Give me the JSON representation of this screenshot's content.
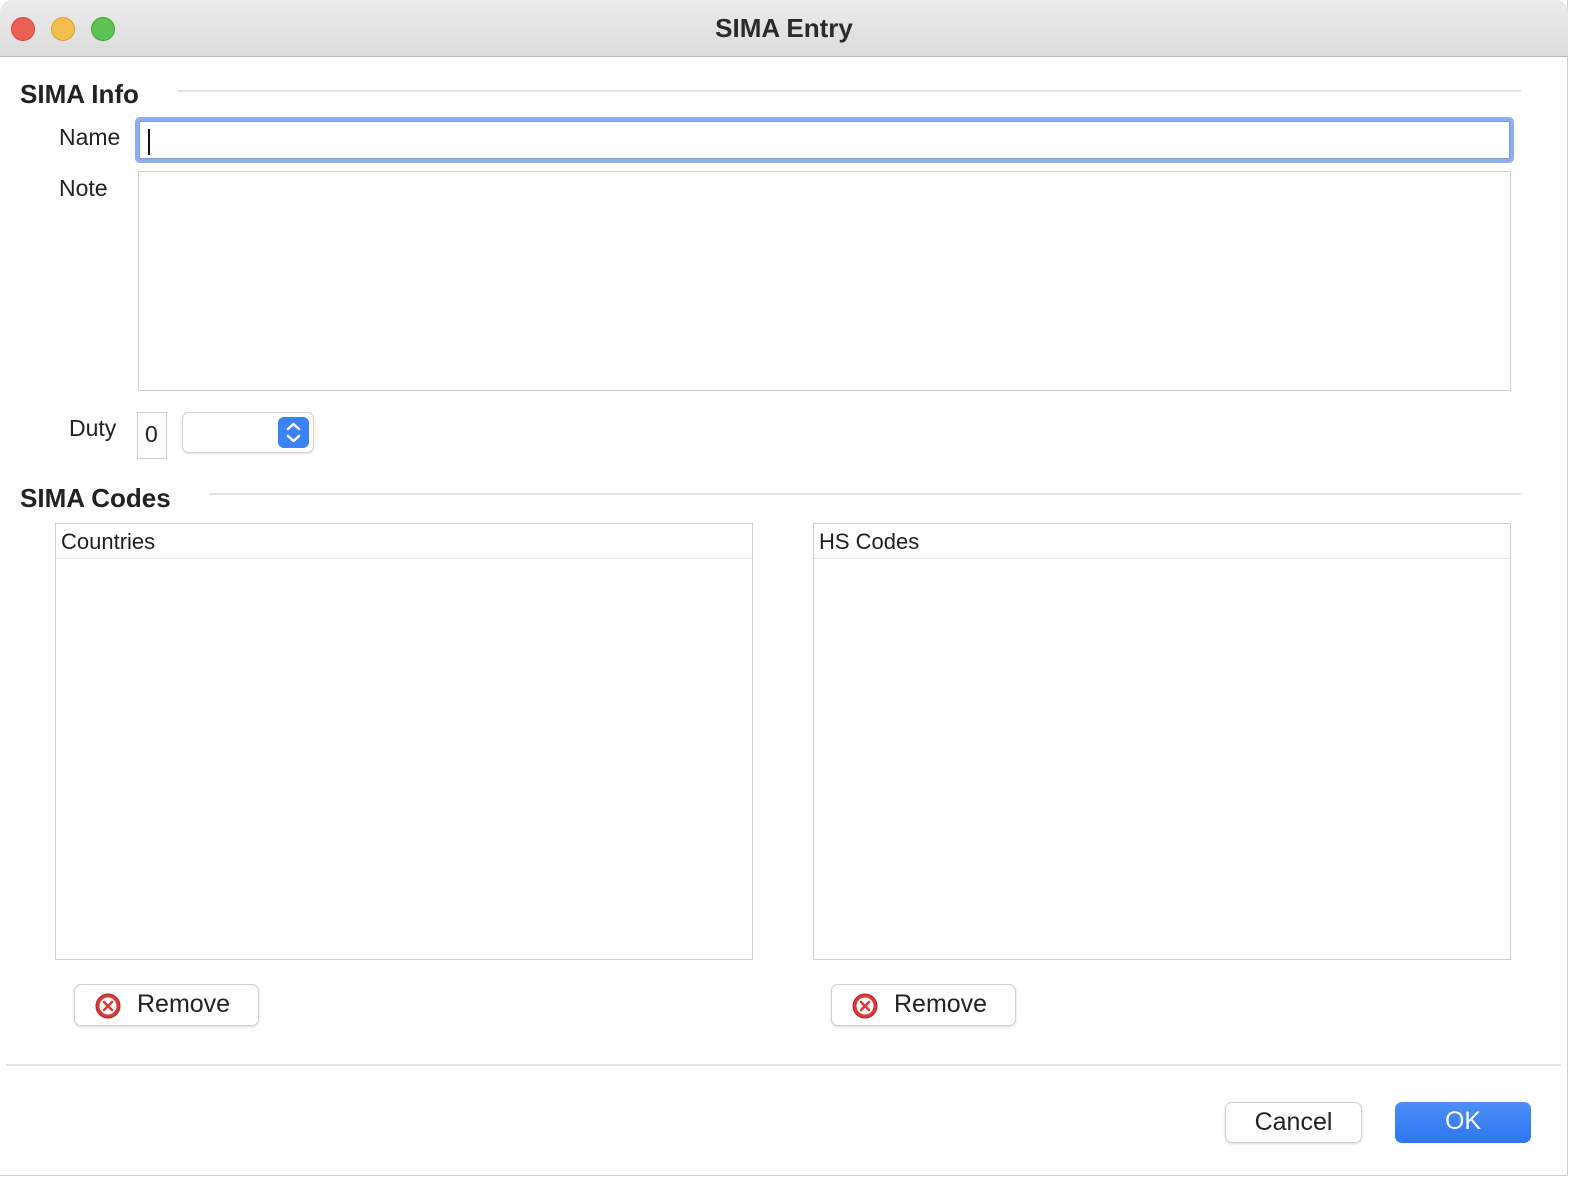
{
  "window": {
    "title": "SIMA Entry"
  },
  "sima_info": {
    "section_title": "SIMA Info",
    "name_label": "Name",
    "name_value": "",
    "note_label": "Note",
    "note_value": "",
    "duty_label": "Duty",
    "duty_value": "0",
    "duty_unit_selected": ""
  },
  "sima_codes": {
    "section_title": "SIMA Codes",
    "countries_header": "Countries",
    "countries_items": [],
    "hs_codes_header": "HS Codes",
    "hs_codes_items": [],
    "remove_countries_label": "Remove",
    "remove_hs_codes_label": "Remove"
  },
  "footer": {
    "cancel_label": "Cancel",
    "ok_label": "OK"
  },
  "colors": {
    "accent": "#3b82f6",
    "focus_ring": "#8cadf2",
    "remove_icon": "#d93a3a"
  },
  "icons": {
    "remove": "remove-icon",
    "stepper": "chevron-up-down-icon"
  }
}
